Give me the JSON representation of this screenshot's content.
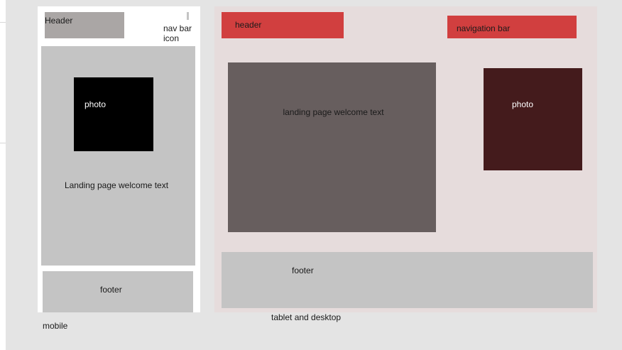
{
  "mobile": {
    "header_label": "Header",
    "nav_icon_label": "nav bar icon",
    "photo_label": "photo",
    "welcome_label": "Landing page welcome text",
    "footer_label": "footer",
    "caption": "mobile"
  },
  "desktop": {
    "header_label": "header",
    "nav_label": "navigation bar",
    "welcome_label": "landing page welcome text",
    "photo_label": "photo",
    "footer_label": "footer",
    "caption": "tablet and desktop"
  },
  "colors": {
    "canvas": "#e4e4e4",
    "mobile_frame": "#ffffff",
    "mobile_header": "#aaa6a5",
    "placeholder_gray": "#c4c4c4",
    "mobile_photo": "#000000",
    "desktop_frame": "#e6dcdc",
    "desktop_header": "#d13f3f",
    "desktop_welcome": "#675e5e",
    "desktop_photo": "#441b1c"
  }
}
